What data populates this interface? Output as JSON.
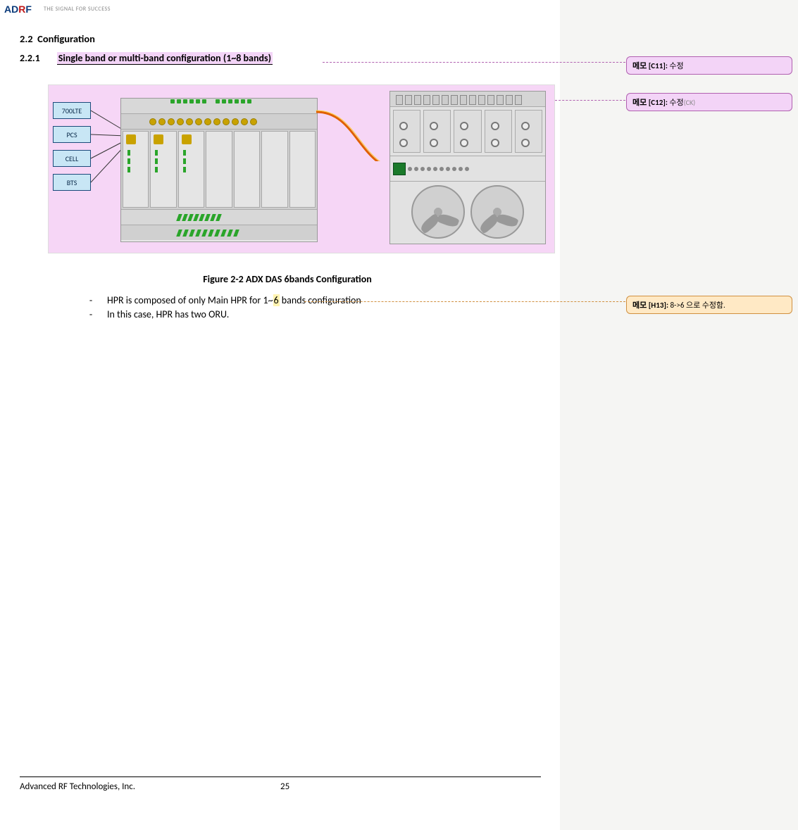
{
  "header": {
    "logo_text": "ADRF",
    "tagline": "THE SIGNAL FOR SUCCESS"
  },
  "section": {
    "number": "2.2",
    "title": "Configuration"
  },
  "subsection": {
    "number": "2.2.1",
    "title": "Single band or multi-band configuration (1~8 bands)"
  },
  "diagram": {
    "bands": [
      "700LTE",
      "PCS",
      "CELL",
      "BTS"
    ]
  },
  "figure_caption": "Figure 2-2     ADX DAS 6bands Configuration",
  "bullets": [
    {
      "pre": "HPR is composed of only Main HPR for 1~",
      "hl": "6",
      "post": " bands configuration"
    },
    {
      "pre": "In this case, HPR has two ORU.",
      "hl": "",
      "post": ""
    }
  ],
  "comments": [
    {
      "label": "메모 [C11]:",
      "text": " 수정",
      "gray": ""
    },
    {
      "label": "메모 [C12]:",
      "text": " 수정",
      "gray": "(CK)"
    },
    {
      "label": "메모 [H13]:",
      "text": " 8->6 으로 수정함.",
      "gray": ""
    }
  ],
  "footer": {
    "company": "Advanced RF Technologies, Inc.",
    "page": "25"
  }
}
